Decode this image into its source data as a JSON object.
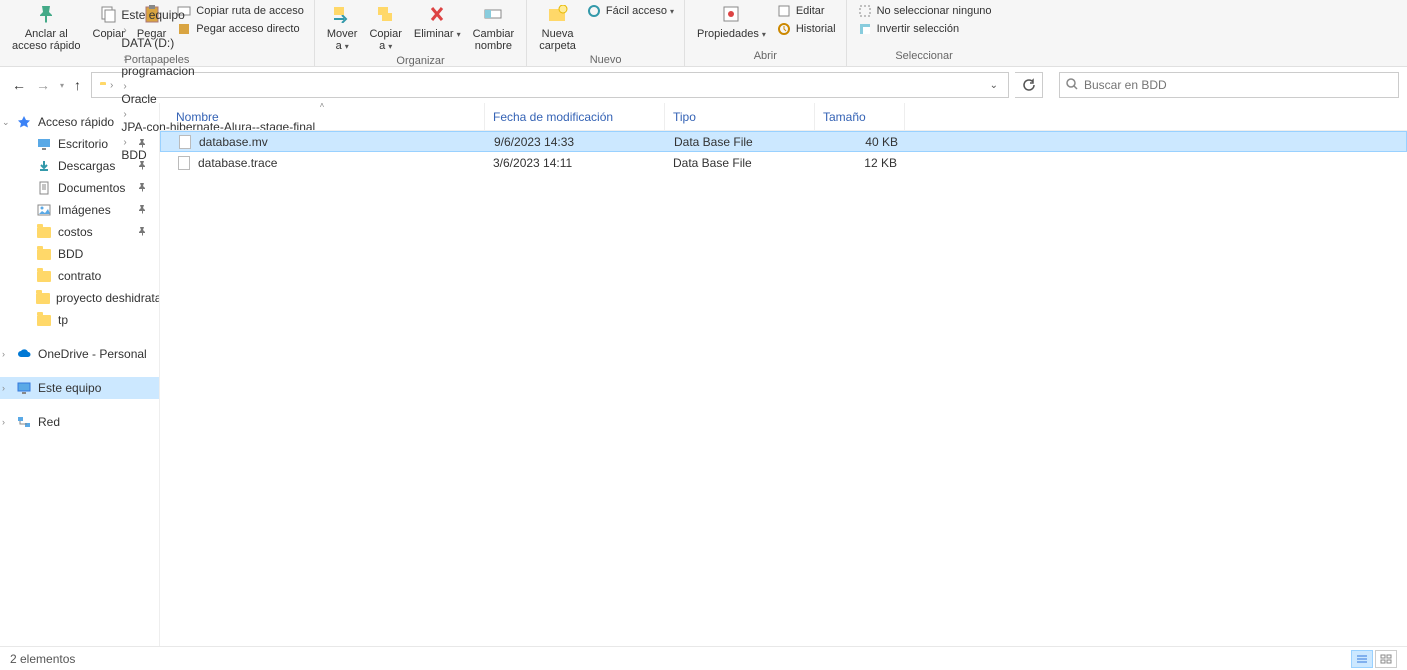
{
  "ribbon": {
    "groups": {
      "clipboard": {
        "label": "Portapapeles",
        "pin": "Anclar al\nacceso rápido",
        "copy": "Copiar",
        "paste": "Pegar",
        "copy_path": "Copiar ruta de acceso",
        "paste_shortcut": "Pegar acceso directo"
      },
      "organize": {
        "label": "Organizar",
        "move_to": "Mover\na",
        "copy_to": "Copiar\na",
        "delete": "Eliminar",
        "rename": "Cambiar\nnombre"
      },
      "new": {
        "label": "Nuevo",
        "new_folder": "Nueva\ncarpeta",
        "easy_access": "Fácil acceso"
      },
      "open": {
        "label": "Abrir",
        "properties": "Propiedades",
        "edit": "Editar",
        "history": "Historial"
      },
      "select": {
        "label": "Seleccionar",
        "select_none": "No seleccionar ninguno",
        "invert": "Invertir selección"
      }
    }
  },
  "breadcrumb": {
    "items": [
      "Este equipo",
      "DATA (D:)",
      "programacion",
      "Oracle",
      "JPA-con-hibernate-Alura--stage-final",
      "BDD"
    ]
  },
  "search": {
    "placeholder": "Buscar en BDD"
  },
  "sidebar": {
    "quick_access": "Acceso rápido",
    "items": [
      {
        "label": "Escritorio",
        "pinned": true,
        "icon": "desktop"
      },
      {
        "label": "Descargas",
        "pinned": true,
        "icon": "downloads"
      },
      {
        "label": "Documentos",
        "pinned": true,
        "icon": "documents"
      },
      {
        "label": "Imágenes",
        "pinned": true,
        "icon": "pictures"
      },
      {
        "label": "costos",
        "pinned": true,
        "icon": "folder"
      },
      {
        "label": "BDD",
        "pinned": false,
        "icon": "folder"
      },
      {
        "label": "contrato",
        "pinned": false,
        "icon": "folder"
      },
      {
        "label": "proyecto deshidrata",
        "pinned": false,
        "icon": "folder"
      },
      {
        "label": "tp",
        "pinned": false,
        "icon": "folder"
      }
    ],
    "onedrive": "OneDrive - Personal",
    "this_pc": "Este equipo",
    "network": "Red"
  },
  "columns": {
    "name": "Nombre",
    "date": "Fecha de modificación",
    "type": "Tipo",
    "size": "Tamaño"
  },
  "files": [
    {
      "name": "database.mv",
      "date": "9/6/2023 14:33",
      "type": "Data Base File",
      "size": "40 KB",
      "selected": true
    },
    {
      "name": "database.trace",
      "date": "3/6/2023 14:11",
      "type": "Data Base File",
      "size": "12 KB",
      "selected": false
    }
  ],
  "status": {
    "text": "2 elementos"
  }
}
